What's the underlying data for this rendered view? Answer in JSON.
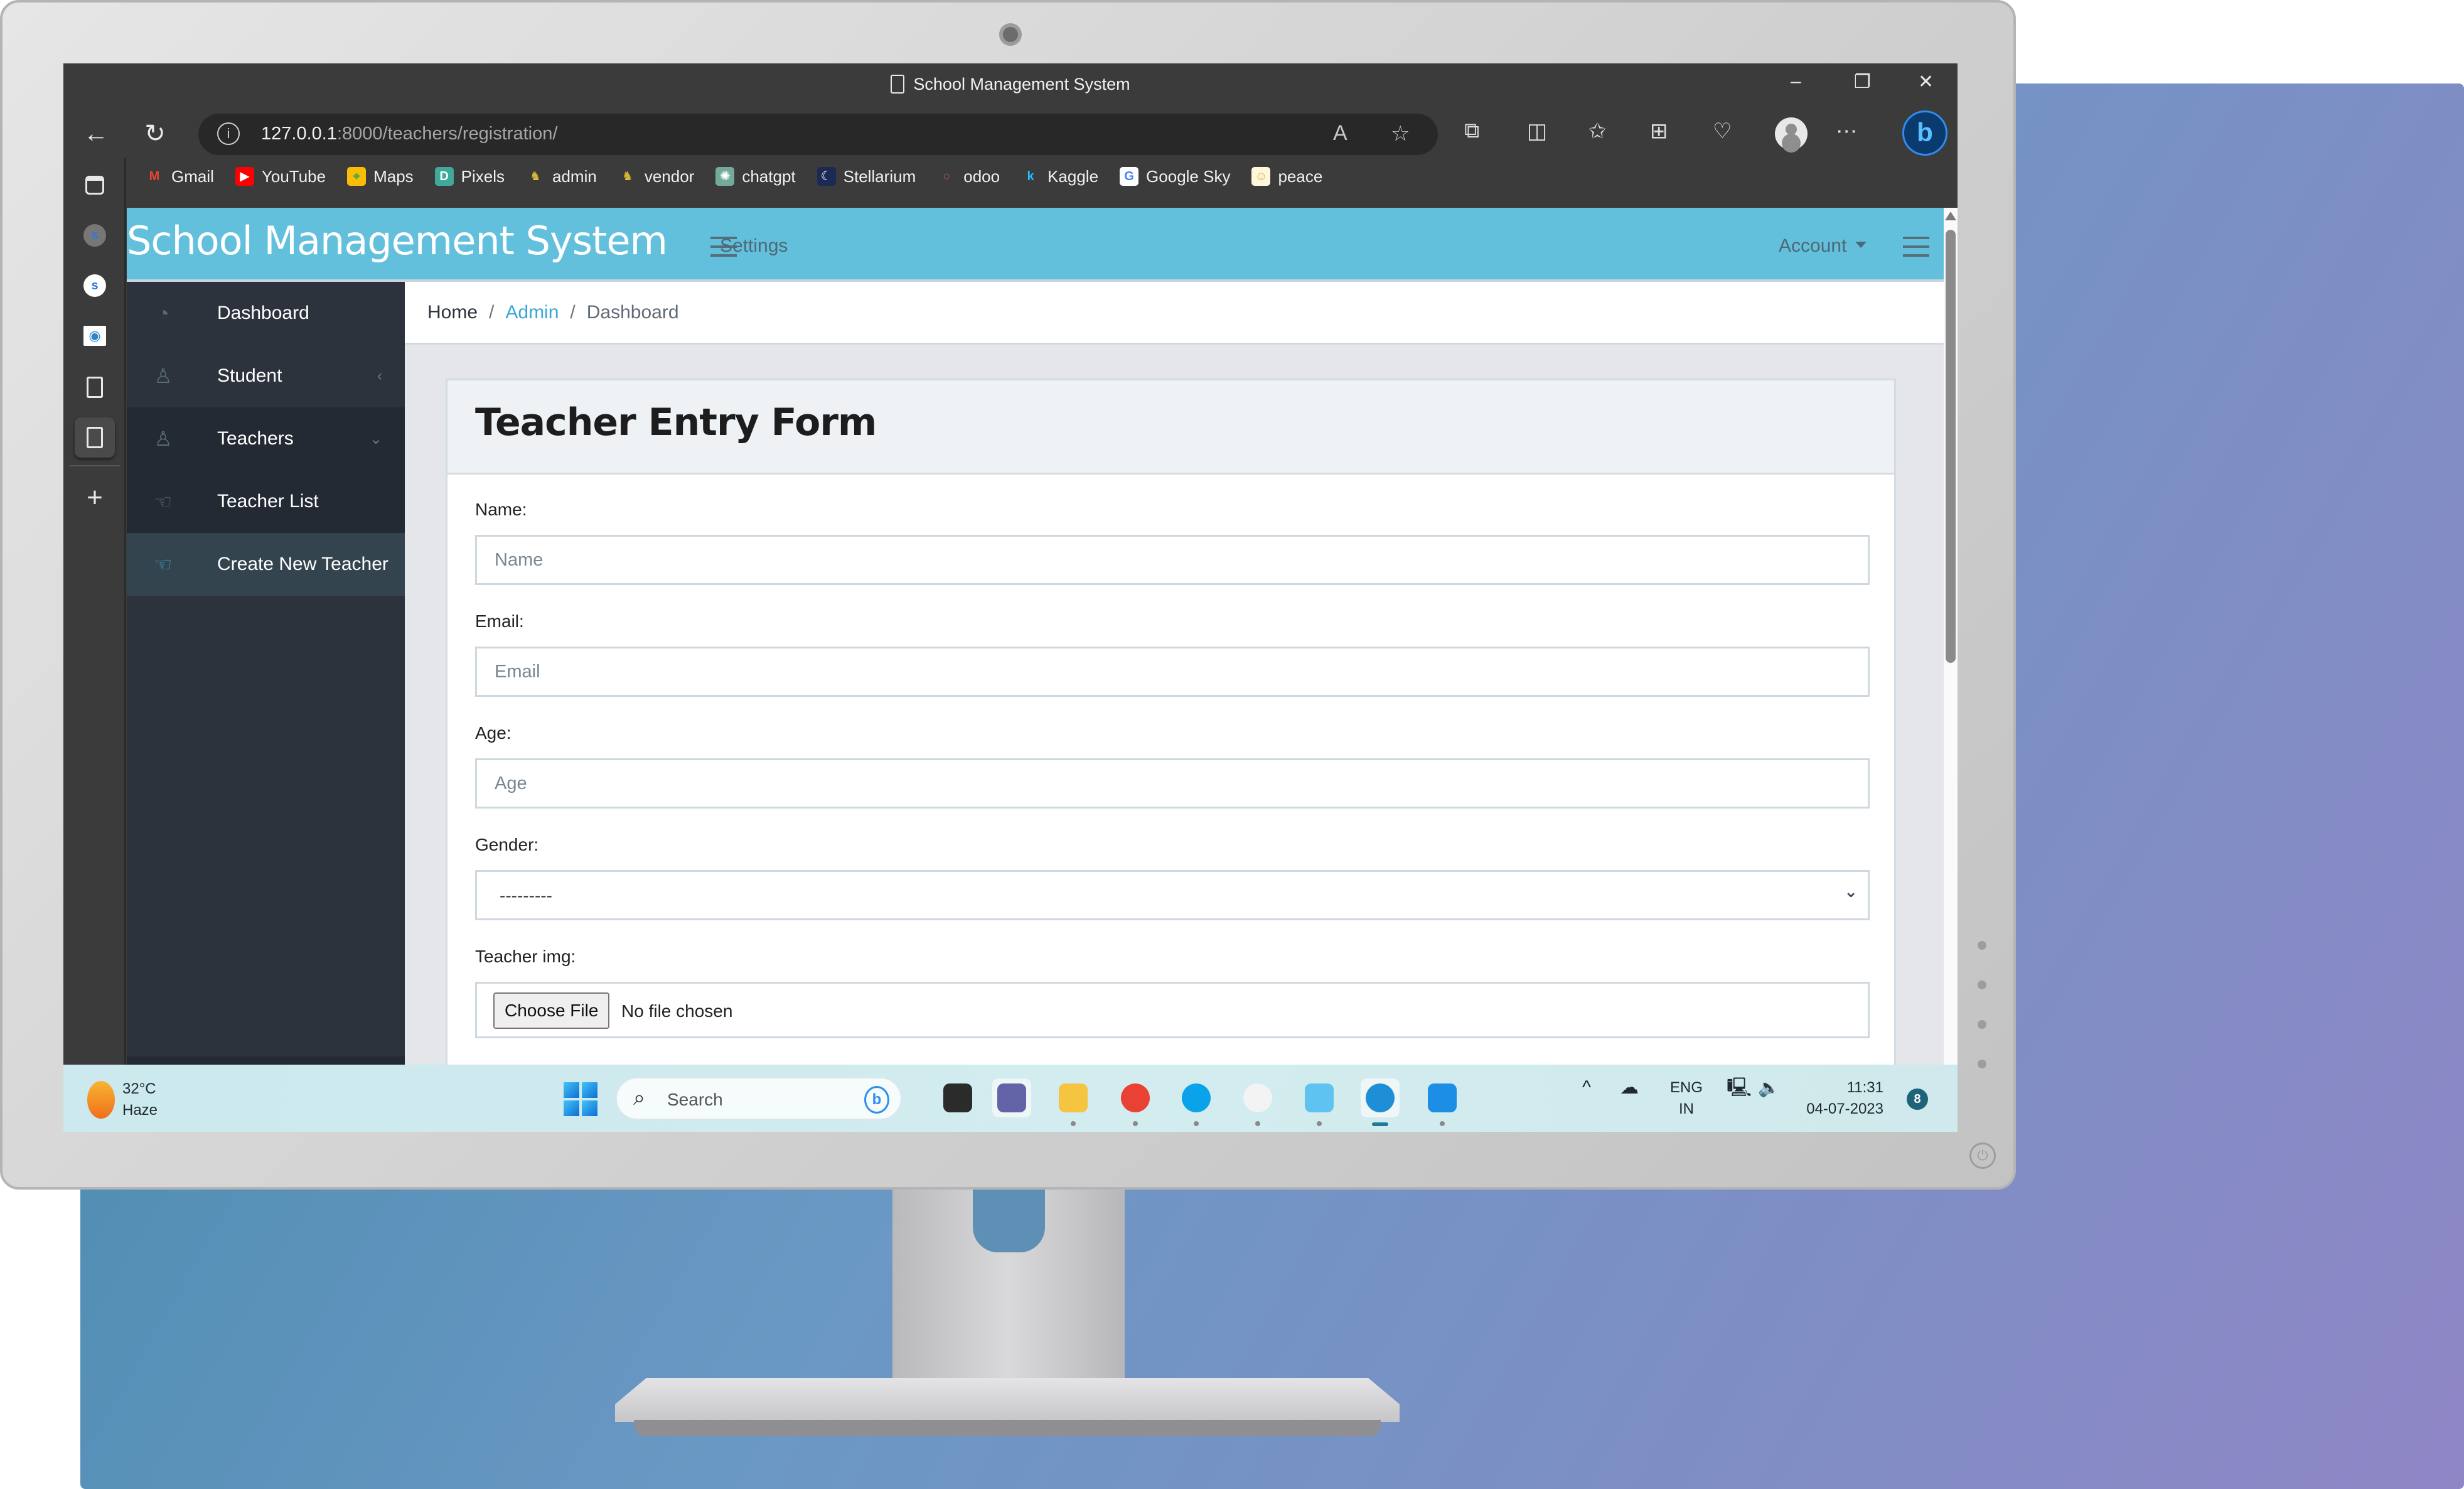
{
  "browser": {
    "window_title": "School Management System",
    "url_host": "127.0.0.1",
    "url_rest": ":8000/teachers/registration/",
    "window_controls": {
      "minimize": "–",
      "restore": "❐",
      "close": "✕"
    },
    "bookmarks": [
      {
        "label": "Gmail",
        "icon": "gmail-icon",
        "glyph": "M",
        "color": "#ea4335",
        "bg": "transparent"
      },
      {
        "label": "YouTube",
        "icon": "youtube-icon",
        "glyph": "▶",
        "color": "#ffffff",
        "bg": "#ff0000"
      },
      {
        "label": "Maps",
        "icon": "maps-icon",
        "glyph": "⌖",
        "color": "#34a853",
        "bg": "#fbbc04"
      },
      {
        "label": "Pixels",
        "icon": "pixels-icon",
        "glyph": "D",
        "color": "#ffffff",
        "bg": "#3fa99b"
      },
      {
        "label": "admin",
        "icon": "admin-icon",
        "glyph": "♞",
        "color": "#d9b83a",
        "bg": "transparent"
      },
      {
        "label": "vendor",
        "icon": "vendor-icon",
        "glyph": "♞",
        "color": "#d9b83a",
        "bg": "transparent"
      },
      {
        "label": "chatgpt",
        "icon": "chatgpt-icon",
        "glyph": "✺",
        "color": "#ffffff",
        "bg": "#74aa9c"
      },
      {
        "label": "Stellarium",
        "icon": "stellarium-icon",
        "glyph": "☾",
        "color": "#ffffff",
        "bg": "#1b2a55"
      },
      {
        "label": "odoo",
        "icon": "odoo-icon",
        "glyph": "○",
        "color": "#a0509a",
        "bg": "transparent"
      },
      {
        "label": "Kaggle",
        "icon": "kaggle-icon",
        "glyph": "k",
        "color": "#20beff",
        "bg": "transparent"
      },
      {
        "label": "Google Sky",
        "icon": "google-icon",
        "glyph": "G",
        "color": "#4285f4",
        "bg": "#ffffff"
      },
      {
        "label": "peace",
        "icon": "peace-icon",
        "glyph": "☺",
        "color": "#e0b34a",
        "bg": "#fff7dc"
      }
    ]
  },
  "app": {
    "brand": "School Management System",
    "settings_label": "Settings",
    "account_label": "Account",
    "breadcrumb": {
      "home": "Home",
      "admin": "Admin",
      "current": "Dashboard"
    },
    "sidebar": [
      {
        "label": "Dashboard",
        "icon": "dashboard-icon",
        "glyph": "◔",
        "caret": ""
      },
      {
        "label": "Student",
        "icon": "user-icon",
        "glyph": "♙",
        "caret": "‹"
      },
      {
        "label": "Teachers",
        "icon": "user-icon",
        "glyph": "♙",
        "caret": "⌄"
      },
      {
        "label": "Teacher List",
        "icon": "hand-icon",
        "glyph": "☜",
        "caret": ""
      },
      {
        "label": "Create New Teacher",
        "icon": "hand-icon",
        "glyph": "☜",
        "caret": ""
      }
    ],
    "sidebar_collapse": "‹"
  },
  "form": {
    "title": "Teacher Entry Form",
    "name_label": "Name:",
    "name_placeholder": "Name",
    "name_value": "",
    "email_label": "Email:",
    "email_placeholder": "Email",
    "email_value": "",
    "age_label": "Age:",
    "age_placeholder": "Age",
    "age_value": "",
    "gender_label": "Gender:",
    "gender_selected": "---------",
    "img_label": "Teacher img:",
    "choose_file_label": "Choose File",
    "no_file_label": "No file chosen"
  },
  "taskbar": {
    "weather_temp": "32°C",
    "weather_desc": "Haze",
    "search_label": "Search",
    "apps": [
      {
        "name": "taskview-icon",
        "color": "#2b2b2b",
        "pip": "none"
      },
      {
        "name": "teams-icon",
        "color": "#6264a7",
        "pip": "none",
        "hl": true
      },
      {
        "name": "file-explorer-icon",
        "color": "#f5c542",
        "pip": "dot"
      },
      {
        "name": "chrome-icon",
        "color": "#e94235",
        "pip": "dot"
      },
      {
        "name": "skype-icon",
        "color": "#0aa2e8",
        "pip": "dot"
      },
      {
        "name": "timer-app-icon",
        "color": "#f3f3f3",
        "pip": "dot"
      },
      {
        "name": "notepad-icon",
        "color": "#5ec3f0",
        "pip": "dot"
      },
      {
        "name": "edge-icon",
        "color": "#1e8fd6",
        "pip": "wide",
        "hl": true
      },
      {
        "name": "vscode-icon",
        "color": "#1c8ee6",
        "pip": "dot"
      }
    ],
    "lang_top": "ENG",
    "lang_bottom": "IN",
    "time": "11:31",
    "date": "04-07-2023",
    "notification_count": "8"
  },
  "colors": {
    "appbar": "#62c0dd",
    "sidebar": "#2c333d",
    "link": "#3aa8d8"
  }
}
